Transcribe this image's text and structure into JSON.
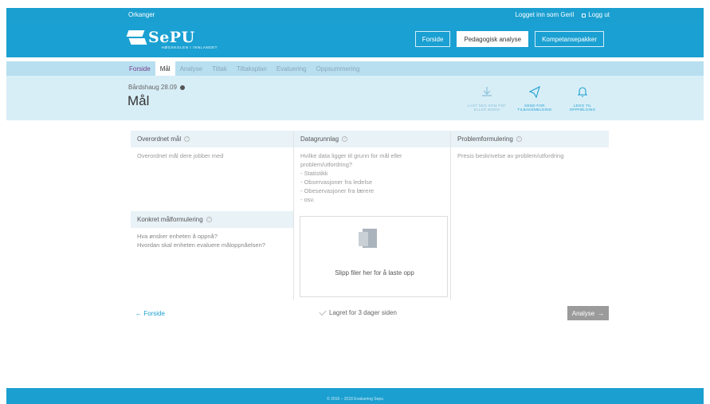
{
  "topbar": {
    "site": "Orkanger",
    "logged_in": "Logget inn som Geril",
    "logout": "Logg ut"
  },
  "brand": {
    "name": "SePU",
    "subtitle": "HØGSKOLEN I INNLANDET"
  },
  "nav": {
    "home": "Forside",
    "analysis": "Pedagogisk analyse",
    "packages": "Kompetansepakker"
  },
  "tabs": [
    "Forside",
    "Mål",
    "Analyse",
    "Tiltak",
    "Tiltaksplan",
    "Evaluering",
    "Oppsummering"
  ],
  "header": {
    "breadcrumb": "Bårdshaug 28.09",
    "title": "Mål"
  },
  "actions": [
    {
      "label": "LAST NED SOM PDF ELLER WORD",
      "icon": "download-icon"
    },
    {
      "label": "SEND FOR TILBAKEMELDING",
      "icon": "paper-plane-icon"
    },
    {
      "label": "LEGG TIL OPPFØLGING",
      "icon": "bell-icon"
    }
  ],
  "columns": {
    "goal": {
      "heading": "Overordnet mål",
      "placeholder": "Overordnet mål dere jobber med"
    },
    "data": {
      "heading": "Datagrunnlag",
      "lines": [
        "Hvilke data ligger til grunn for mål eller",
        "problem/utfordring?",
        "- Statistikk",
        "- Observasjoner fra ledelse",
        "- Obeservasjoner fra lærere",
        "- osv."
      ]
    },
    "problem": {
      "heading": "Problemformulering",
      "placeholder": "Presis beskrivelse av problem/utfordring"
    },
    "concrete": {
      "heading": "Konkret målformulering",
      "lines": [
        "Hva ønsker enheten å oppnå?",
        "Hvordan skal enheten evaluere måloppnåelsen?"
      ]
    }
  },
  "dropzone": {
    "text": "Slipp filer her for å laste opp"
  },
  "footer": {
    "back": "Forside",
    "saved": "Lagret for 3 dager siden",
    "next": "Analyse"
  },
  "copyright": "© 2016 – 2018 Evaluering Sepu"
}
